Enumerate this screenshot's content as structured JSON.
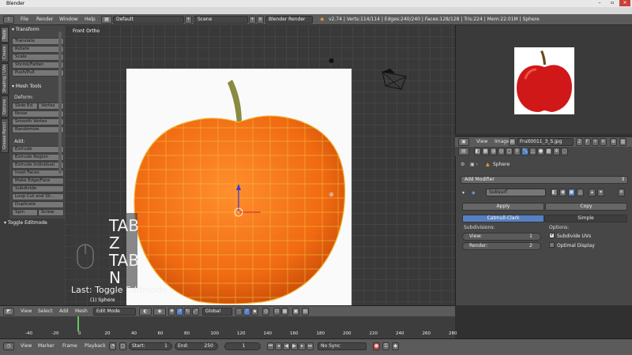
{
  "window": {
    "title": "Blender"
  },
  "topbar": {
    "menus": [
      "File",
      "Render",
      "Window",
      "Help"
    ],
    "layout": "Default",
    "scene": "Scene",
    "engine": "Blender Render",
    "stats": "v2.74 | Verts:114/114 | Edges:240/240 | Faces:128/128 | Tris:224 | Mem:22.01M | Sphere"
  },
  "side_tabs": [
    "Tools",
    "Create",
    "Shading / UVs",
    "Options",
    "Grease Pencil"
  ],
  "toolshelf": {
    "transform_title": "Transform",
    "transform": [
      "Translate",
      "Rotate",
      "Scale",
      "Shrink/Fatten",
      "Push/Pull"
    ],
    "mesh_tools_title": "Mesh Tools",
    "deform_label": "Deform:",
    "deform_pair": [
      "Slide Ed",
      "Vertex"
    ],
    "deform": [
      "Noise",
      "Smooth Vertex",
      "Randomize"
    ],
    "add_label": "Add:",
    "extrude_dd": "Extrude",
    "add": [
      "Extrude Region",
      "Extrude Individual",
      "Inset Faces",
      "Make Edge/Face",
      "Subdivide",
      "Loop Cut and Sli...",
      "Duplicate"
    ],
    "spin_pair": [
      "Spin",
      "Screw"
    ],
    "operator": "Toggle Editmode"
  },
  "viewport": {
    "label": "Front Ortho",
    "keys": [
      "TAB",
      "Z",
      "TAB",
      "N"
    ],
    "last_op": "Last: Toggle Editmode",
    "object": "(1) Sphere"
  },
  "image_header": {
    "menus": [
      "View",
      "Image"
    ],
    "image_name": "Fruit0011_3_S.jpg",
    "users": "2",
    "fake": "F"
  },
  "properties": {
    "object": "Sphere",
    "add_modifier": "Add Modifier",
    "modifier_name": "Subsurf",
    "apply": "Apply",
    "copy": "Copy",
    "catmull": "Catmull-Clark",
    "simple": "Simple",
    "subdivisions_label": "Subdivisions:",
    "view_label": "View:",
    "view_value": "1",
    "render_label": "Render:",
    "render_value": "2",
    "options_label": "Options:",
    "subdivide_uvs": "Subdivide UVs",
    "optimal_display": "Optimal Display"
  },
  "vp_header": {
    "menus": [
      "View",
      "Select",
      "Add",
      "Mesh"
    ],
    "mode": "Edit Mode",
    "orientation": "Global"
  },
  "timeline": {
    "ticks": [
      "-40",
      "-20",
      "0",
      "20",
      "40",
      "60",
      "80",
      "100",
      "120",
      "140",
      "160",
      "180",
      "200",
      "220",
      "240",
      "260",
      "280"
    ]
  },
  "tl_header": {
    "menus": [
      "View",
      "Marker",
      "Frame",
      "Playback"
    ],
    "start_label": "Start:",
    "start": "1",
    "end_label": "End:",
    "end": "250",
    "current": "1",
    "sync": "No Sync"
  },
  "colors": {
    "accent_blue": "#5680c2",
    "apple": "#ff7a1e",
    "wire": "#f0b030"
  }
}
